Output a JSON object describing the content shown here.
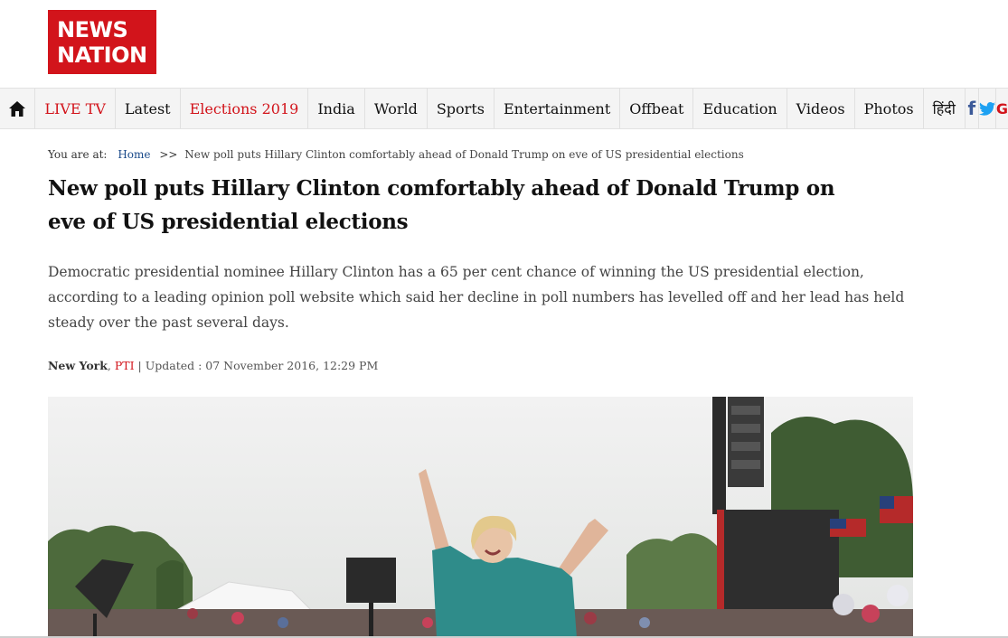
{
  "logo": {
    "line1": "NEWS",
    "line2": "NATION"
  },
  "nav": {
    "home_icon": "home-icon",
    "items": [
      {
        "label": "LIVE TV",
        "color": "#d2141b"
      },
      {
        "label": "Latest"
      },
      {
        "label": "Elections 2019",
        "color": "#d2141b"
      },
      {
        "label": "India"
      },
      {
        "label": "World"
      },
      {
        "label": "Sports"
      },
      {
        "label": "Entertainment"
      },
      {
        "label": "Offbeat"
      },
      {
        "label": "Education"
      },
      {
        "label": "Videos"
      },
      {
        "label": "Photos"
      },
      {
        "label": "हिंदी"
      }
    ],
    "social": {
      "facebook_glyph": "f",
      "twitter_icon": "twitter-icon",
      "google_glyph": "G"
    }
  },
  "breadcrumb": {
    "prefix": "You are at:",
    "home": "Home",
    "separator": ">>",
    "current": "New poll puts Hillary Clinton comfortably ahead of Donald Trump on eve of US presidential elections"
  },
  "article": {
    "title": "New poll puts Hillary Clinton comfortably ahead of Donald Trump on eve of US presidential elections",
    "summary": "Democratic presidential nominee Hillary Clinton has a 65 per cent chance of winning the US presidential election, according to a leading opinion poll website which said her decline in poll numbers has levelled off and her lead has held steady over the past several days.",
    "byline": {
      "location": "New York",
      "source": "PTI",
      "updated": "| Updated : 07 November 2016, 12:29 PM"
    },
    "hero_image": "rally-photo"
  },
  "colors": {
    "brand_red": "#d2141b",
    "facebook": "#3b5998",
    "twitter": "#1da1f2"
  }
}
